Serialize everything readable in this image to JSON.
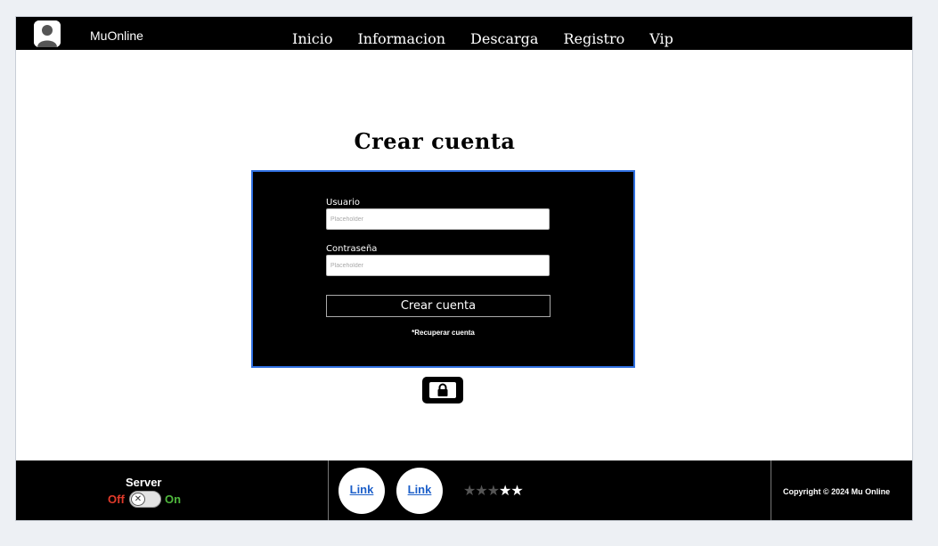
{
  "header": {
    "brand": "MuOnline",
    "nav": [
      "Inicio",
      "Informacion",
      "Descarga",
      "Registro",
      "Vip"
    ]
  },
  "main": {
    "title": "Crear cuenta",
    "user_label": "Usuario",
    "user_placeholder": "Placeholder",
    "pass_label": "Contraseña",
    "pass_placeholder": "Placeholder",
    "submit_label": "Crear cuenta",
    "recover_text": "*Recuperar cuenta",
    "lock_icon": "lock-icon"
  },
  "footer": {
    "server_title": "Server",
    "off_label": "Off",
    "on_label": "On",
    "link1": "Link",
    "link2": "Link",
    "rating": {
      "filled": 2,
      "total": 5,
      "filled_color": "#ffffff",
      "empty_color": "#555555"
    },
    "copyright": "Copyright © 2024 Mu Online"
  },
  "colors": {
    "accent_border": "#2f6fe0",
    "off_color": "#e23a2a",
    "on_color": "#4fb83d",
    "link_color": "#1c5fc9"
  }
}
